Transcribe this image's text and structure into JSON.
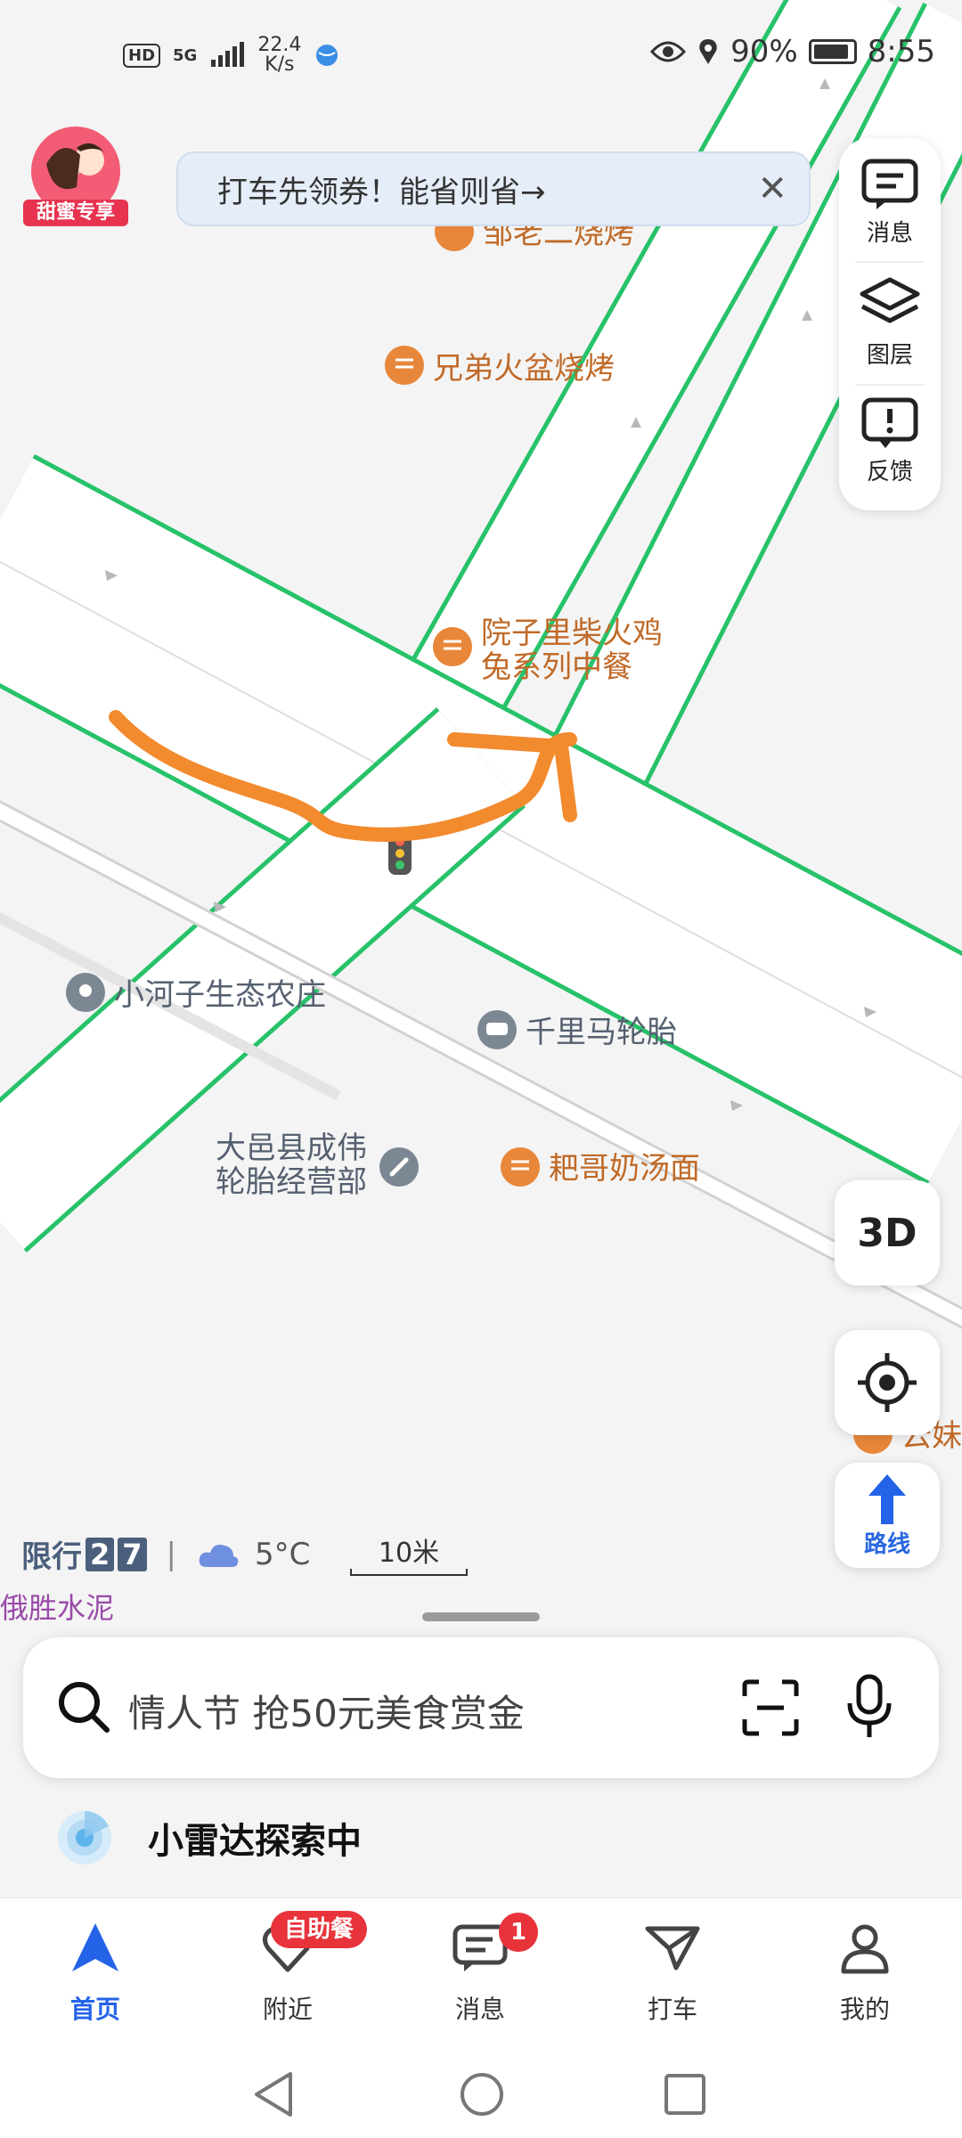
{
  "status_bar": {
    "hd": "HD",
    "network": "5G",
    "speed_value": "22.4",
    "speed_unit": "K/s",
    "battery": "90%",
    "time": "8:55"
  },
  "avatar": {
    "label": "甜蜜专享"
  },
  "promo_banner": {
    "text": "打车先领券！能省则省→"
  },
  "side_panel": {
    "messages": "消息",
    "layers": "图层",
    "feedback": "反馈"
  },
  "map": {
    "pois": {
      "zou_bbq": "邹老二烧烤",
      "xiongdi": "兄弟火盆烧烤",
      "yuanzi_line1": "院子里柴火鸡",
      "yuanzi_line2": "兔系列中餐",
      "farm": "小河子生态农庄",
      "tire": "千里马轮胎",
      "chengwei_line1": "大邑县成伟",
      "chengwei_line2": "轮胎经营部",
      "noodle": "耙哥奶汤面",
      "yunmei": "云妹"
    }
  },
  "controls": {
    "three_d": "3D",
    "route": "路线"
  },
  "info_bar": {
    "restriction_label": "限行",
    "restriction_digits": [
      "2",
      "7"
    ],
    "separator": "|",
    "temperature": "5°C",
    "scale": "10米"
  },
  "map_label_partial": "俄胜水泥",
  "search": {
    "placeholder": "情人节 抢50元美食赏金"
  },
  "radar": {
    "text": "小雷达探索中"
  },
  "tabs": [
    {
      "label": "首页"
    },
    {
      "label": "附近",
      "badge": "自助餐"
    },
    {
      "label": "消息",
      "badge": "1"
    },
    {
      "label": "打车"
    },
    {
      "label": "我的"
    }
  ],
  "colors": {
    "accent": "#2463e8",
    "road_edge": "#27c26a",
    "poi_food": "#e8873a",
    "drawn_arrow": "#f28a2e",
    "badge": "#e8333b"
  }
}
